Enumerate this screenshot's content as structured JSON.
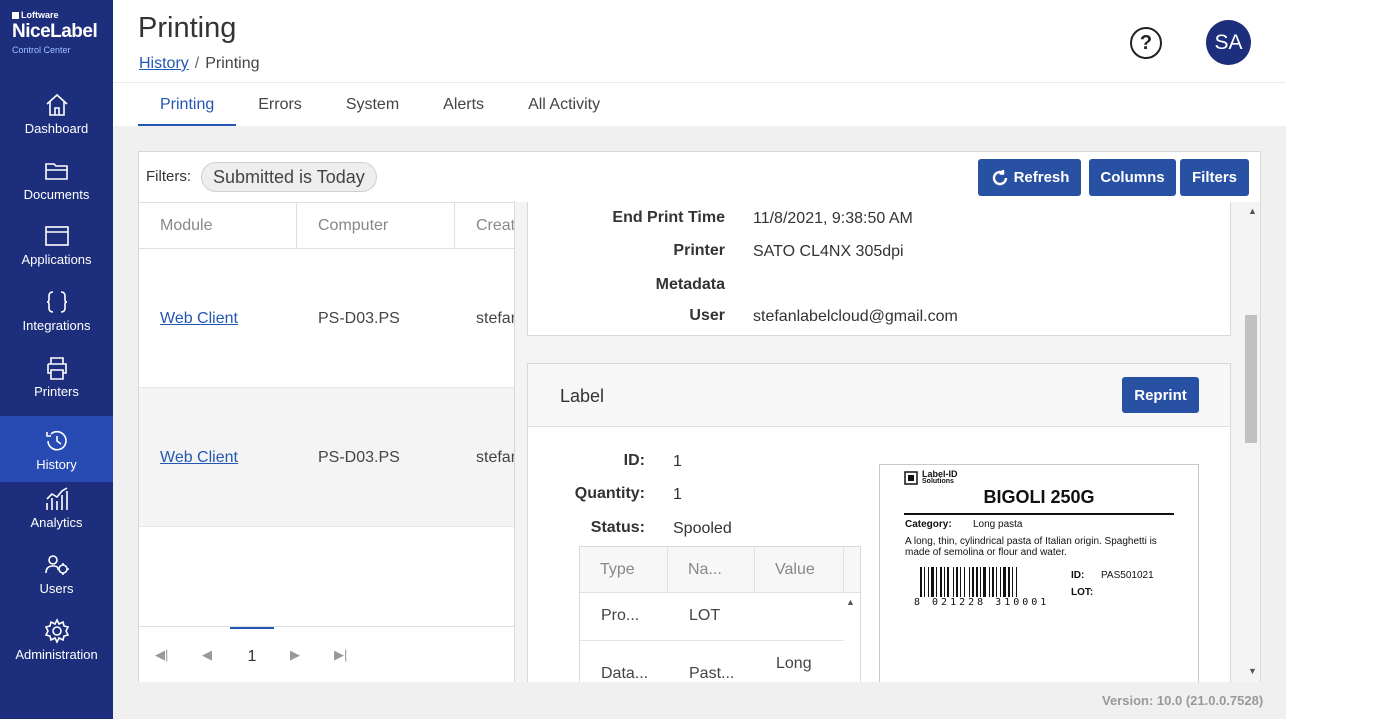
{
  "brand": {
    "vendor": "Loftware",
    "product": "NiceLabel",
    "sub": "Control Center"
  },
  "nav": [
    {
      "label": "Dashboard",
      "icon": "home-icon"
    },
    {
      "label": "Documents",
      "icon": "folder-icon"
    },
    {
      "label": "Applications",
      "icon": "window-icon"
    },
    {
      "label": "Integrations",
      "icon": "braces-icon"
    },
    {
      "label": "Printers",
      "icon": "printer-icon"
    },
    {
      "label": "History",
      "icon": "history-icon",
      "active": true
    },
    {
      "label": "Analytics",
      "icon": "analytics-icon"
    },
    {
      "label": "Users",
      "icon": "users-icon"
    },
    {
      "label": "Administration",
      "icon": "gear-icon"
    }
  ],
  "header": {
    "title": "Printing",
    "breadcrumb": {
      "link": "History",
      "current": "Printing"
    },
    "help": "?",
    "avatar": "SA"
  },
  "tabs": [
    "Printing",
    "Errors",
    "System",
    "Alerts",
    "All Activity"
  ],
  "toolbar": {
    "filters_label": "Filters:",
    "filter_chip": "Submitted is Today",
    "refresh": "Refresh",
    "columns": "Columns",
    "filters": "Filters"
  },
  "grid": {
    "columns": [
      "Module",
      "Computer",
      "Created"
    ],
    "rows": [
      {
        "module": "Web Client",
        "computer": "PS-D03.PS",
        "created": "stefanlabelcloud"
      },
      {
        "module": "Web Client",
        "computer": "PS-D03.PS",
        "created": "stefanlabelcloud"
      }
    ],
    "page": "1"
  },
  "details": {
    "end_print_time_label": "End Print Time",
    "end_print_time": "11/8/2021, 9:38:50 AM",
    "printer_label": "Printer",
    "printer": "SATO CL4NX 305dpi",
    "metadata_label": "Metadata",
    "user_label": "User",
    "user": "stefanlabelcloud@gmail.com"
  },
  "label": {
    "title": "Label",
    "reprint": "Reprint",
    "id_label": "ID:",
    "id": "1",
    "quantity_label": "Quantity:",
    "quantity": "1",
    "status_label": "Status:",
    "status": "Spooled",
    "table": {
      "headers": [
        "Type",
        "Na...",
        "Value"
      ],
      "rows": [
        {
          "type": "Pro...",
          "name": "LOT",
          "value": ""
        },
        {
          "type": "Data...",
          "name": "Past...",
          "value": "Long"
        }
      ]
    }
  },
  "preview": {
    "logo_line1": "Label-ID",
    "logo_line2": "Solutions",
    "product": "BIGOLI 250G",
    "category_label": "Category:",
    "category": "Long pasta",
    "description": "A long, thin, cylindrical pasta of Italian origin. Spaghetti is made of semolina or flour and water.",
    "barcode_digits": "8 021228 310001",
    "id_label": "ID:",
    "id": "PAS501021",
    "lot_label": "LOT:"
  },
  "version": "Version: 10.0 (21.0.0.7528)"
}
